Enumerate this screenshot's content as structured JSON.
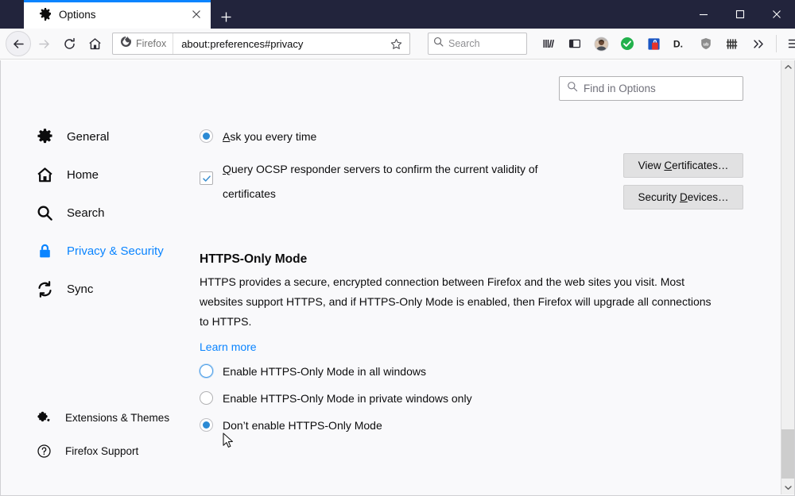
{
  "window": {
    "titlebar_color": "#22243c",
    "accent_color": "#0a84ff",
    "controls": [
      {
        "name": "minimize",
        "glyph": "—"
      },
      {
        "name": "maximize",
        "glyph": "□"
      },
      {
        "name": "close",
        "glyph": "✕"
      }
    ]
  },
  "tabs": [
    {
      "title": "Options",
      "favicon": "gear-icon",
      "active": true
    }
  ],
  "newtab_label": "+",
  "navbar": {
    "back_label": "Back",
    "forward_label": "Forward",
    "reload_label": "Reload",
    "home_label": "Home",
    "identity_label": "Firefox",
    "url": "about:preferences#privacy",
    "star_label": "Bookmark this page",
    "search_placeholder": "Search",
    "icons": [
      {
        "name": "library-icon"
      },
      {
        "name": "sidebar-icon"
      },
      {
        "name": "account-avatar"
      },
      {
        "name": "green-check-extension-icon"
      },
      {
        "name": "password-manager-extension-icon"
      },
      {
        "name": "dashlane-extension-icon"
      },
      {
        "name": "ublock-shield-extension-icon"
      },
      {
        "name": "fence-extension-icon"
      },
      {
        "name": "overflow-chevron-icon"
      }
    ],
    "menu_label": "Open application menu"
  },
  "find": {
    "placeholder": "Find in Options",
    "icon": "search-icon"
  },
  "sidebar": {
    "items": [
      {
        "label": "General",
        "icon": "gear-icon",
        "selected": false
      },
      {
        "label": "Home",
        "icon": "home-icon",
        "selected": false
      },
      {
        "label": "Search",
        "icon": "search-icon",
        "selected": false
      },
      {
        "label": "Privacy & Security",
        "icon": "lock-icon",
        "selected": true
      },
      {
        "label": "Sync",
        "icon": "sync-icon",
        "selected": false
      }
    ],
    "footer": [
      {
        "label": "Extensions & Themes",
        "icon": "puzzle-icon"
      },
      {
        "label": "Firefox Support",
        "icon": "question-circle-icon"
      }
    ]
  },
  "certificates": {
    "ask_every_time": {
      "label": "Ask you every time",
      "accesskey": "A",
      "rest": "sk you every time",
      "checked": true
    },
    "ocsp": {
      "accesskey": "Q",
      "rest": "uery OCSP responder servers to confirm the current validity of certificates",
      "label": "Query OCSP responder servers to confirm the current validity of certificates",
      "checked": true
    },
    "buttons": [
      {
        "prefix": "View ",
        "accesskey": "C",
        "suffix": "ertificates…",
        "label": "View Certificates…"
      },
      {
        "prefix": "Security ",
        "accesskey": "D",
        "suffix": "evices…",
        "label": "Security Devices…"
      }
    ]
  },
  "https_only": {
    "heading": "HTTPS-Only Mode",
    "description": "HTTPS provides a secure, encrypted connection between Firefox and the web sites you visit. Most websites support HTTPS, and if HTTPS-Only Mode is enabled, then Firefox will upgrade all connections to HTTPS.",
    "learn_more": "Learn more",
    "options": [
      {
        "label": "Enable HTTPS-Only Mode in all windows",
        "checked": false,
        "hovered": true
      },
      {
        "label": "Enable HTTPS-Only Mode in private windows only",
        "checked": false,
        "hovered": false
      },
      {
        "label": "Don’t enable HTTPS-Only Mode",
        "checked": true,
        "hovered": false
      }
    ]
  },
  "scrollbar": {
    "up_glyph": "⌃",
    "down_glyph": "⌄"
  }
}
